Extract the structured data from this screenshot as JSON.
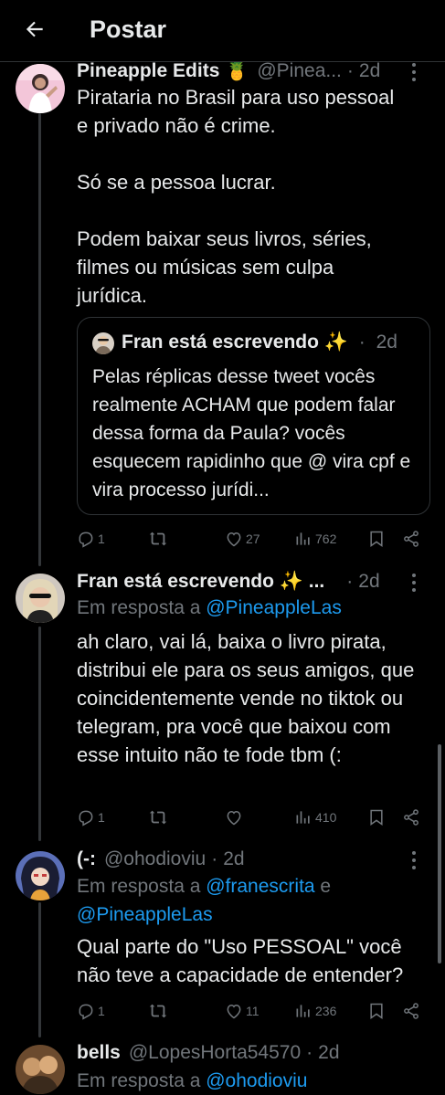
{
  "header": {
    "title": "Postar"
  },
  "tweets": [
    {
      "name": "Pineapple Edits 🍍",
      "handle": "@Pinea...",
      "time": "2d",
      "text": "Pirataria no Brasil para uso pessoal\ne privado não é crime.\n\nSó se a pessoa lucrar.\n\nPodem baixar seus livros, séries,\nfilmes ou músicas sem culpa\njurídica.",
      "quote": {
        "name": "Fran está escrevendo ✨",
        "time": "2d",
        "text": "Pelas réplicas desse tweet vocês realmente ACHAM que podem falar dessa forma da Paula? vocês esquecem rapidinho que @ vira cpf e vira processo jurídi..."
      },
      "stats": {
        "replies": "1",
        "retweets": "",
        "likes": "27",
        "views": "762"
      }
    },
    {
      "name": "Fran está escrevendo ✨ ...",
      "time": "2d",
      "reply_prefix": "Em resposta a ",
      "reply_to": "@PineappleLas",
      "text": "ah claro, vai lá, baixa o livro pirata, distribui ele para os seus amigos, que coincidentemente vende no tiktok ou telegram, pra você que baixou com esse intuito não te fode tbm (:",
      "stats": {
        "replies": "1",
        "retweets": "",
        "likes": "",
        "views": "410"
      }
    },
    {
      "name": "(-:",
      "handle": "@ohodioviu",
      "time": "2d",
      "reply_prefix": "Em resposta a ",
      "reply_to_1": "@franescrita",
      "reply_and": " e",
      "reply_to_2": "@PineappleLas",
      "text": "Qual parte do \"Uso PESSOAL\" você não teve a capacidade de entender?",
      "stats": {
        "replies": "1",
        "retweets": "",
        "likes": "11",
        "views": "236"
      }
    },
    {
      "name": "bells",
      "handle": "@LopesHorta54570",
      "time": "2d",
      "reply_prefix": "Em resposta a ",
      "reply_to": "@ohodioviu"
    }
  ],
  "icons": {
    "back": "arrow-left-icon",
    "reply": "reply-icon",
    "retweet": "retweet-icon",
    "like": "heart-icon",
    "views": "views-icon",
    "bookmark": "bookmark-icon",
    "share": "share-icon",
    "more": "more-icon"
  },
  "colors": {
    "background": "#000000",
    "text": "#e7e9ea",
    "muted": "#71767b",
    "link": "#1d9bf0",
    "border": "#2f3336"
  }
}
